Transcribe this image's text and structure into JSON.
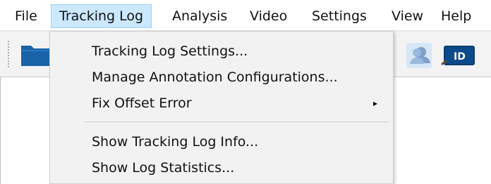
{
  "menubar": {
    "items": [
      {
        "label": "File"
      },
      {
        "label": "Tracking Log"
      },
      {
        "label": "Analysis"
      },
      {
        "label": "Video"
      },
      {
        "label": "Settings"
      },
      {
        "label": "View"
      },
      {
        "label": "Help"
      }
    ],
    "active_index": 1
  },
  "toolbar": {
    "icons": [
      "folder-icon",
      "person-icon",
      "id-icon"
    ],
    "id_badge_text": "ID"
  },
  "tracking_log_menu": {
    "items": [
      {
        "label": "Tracking Log Settings..."
      },
      {
        "label": "Manage Annotation Configurations..."
      },
      {
        "label": "Fix Offset Error",
        "submenu_arrow": "▸"
      },
      {
        "label": "Show Tracking Log Info..."
      },
      {
        "label": "Show Log Statistics..."
      }
    ]
  },
  "colors": {
    "menu_highlight_bg": "#cce8ff",
    "menu_highlight_border": "#99d1ff",
    "dropdown_bg": "#f2f2f2",
    "toolbar_bg": "#f3f3f3",
    "folder_blue": "#1b63a8",
    "person_blue": "#8fb4db",
    "id_dark_blue": "#0b3d73"
  }
}
